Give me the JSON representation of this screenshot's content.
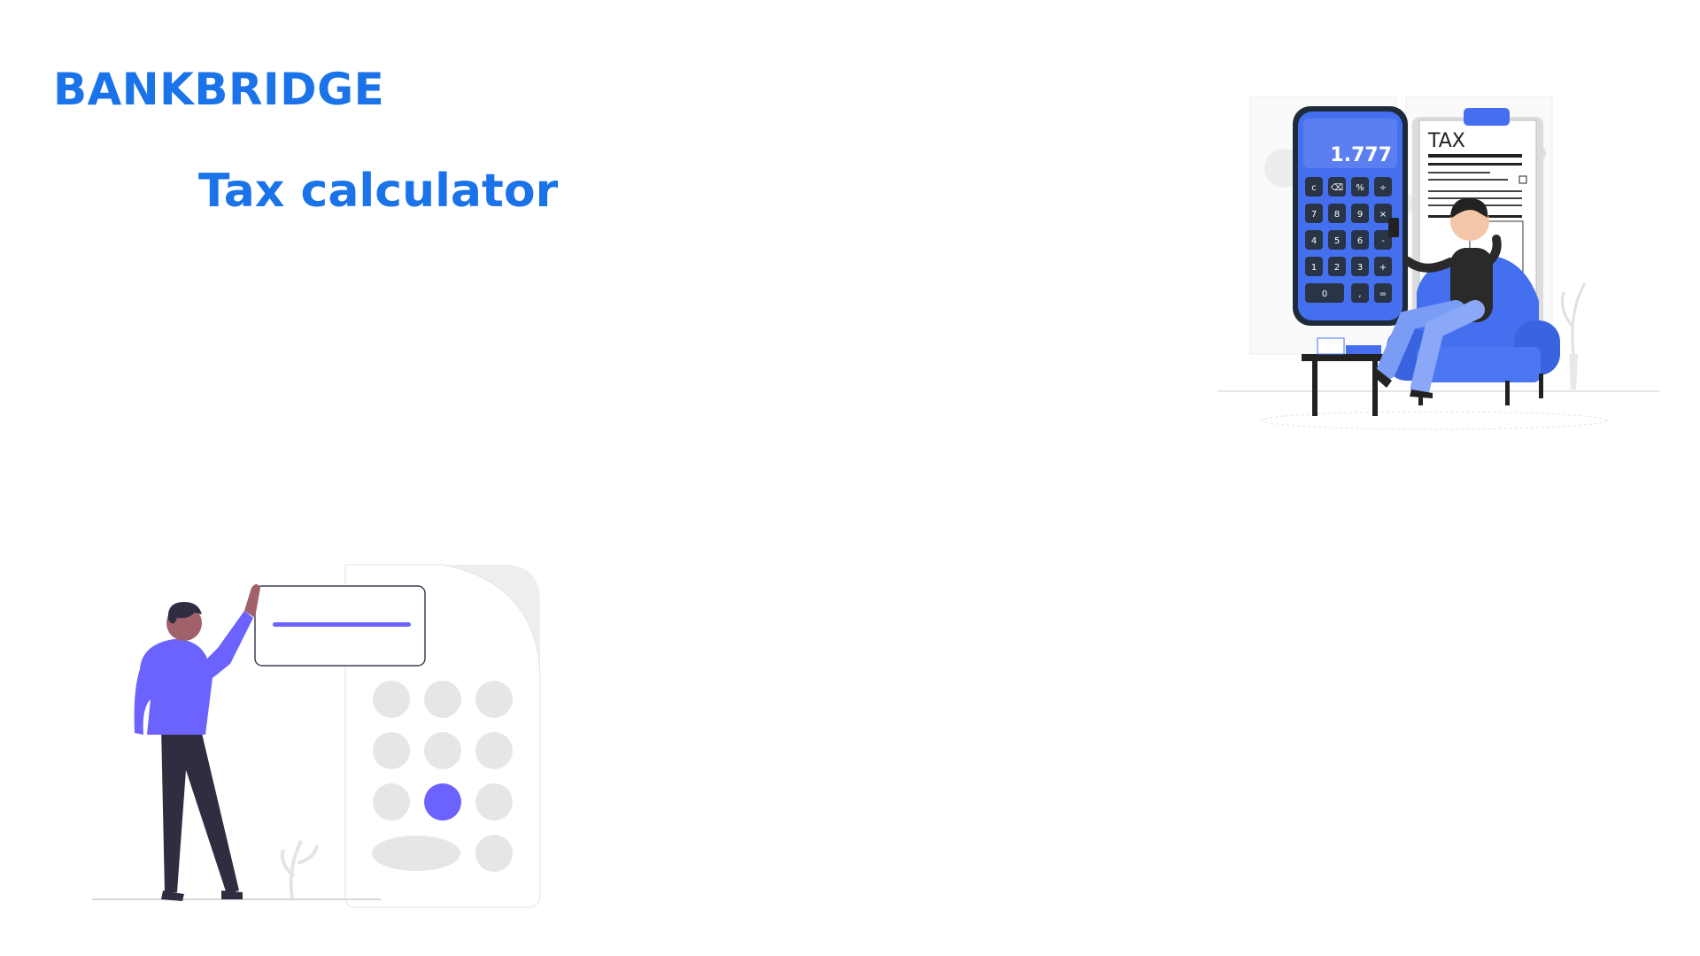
{
  "header": {
    "brand": "BANKBRIDGE",
    "title": "Tax calculator"
  },
  "illustrations": {
    "right": {
      "icon": "man-with-phone-calculator-and-tax-form-illustration",
      "display_value": "1.777",
      "form_label": "TAX",
      "keypad_keys": [
        "c",
        "⌫",
        "%",
        "÷",
        "7",
        "8",
        "9",
        "×",
        "4",
        "5",
        "6",
        "-",
        "1",
        "2",
        "3",
        "+",
        "0",
        ",",
        "="
      ]
    },
    "left": {
      "icon": "man-at-giant-calculator-illustration"
    }
  },
  "colors": {
    "brand": "#1a73e8",
    "illustration_blue": "#4470f0",
    "illustration_purple": "#6c63ff",
    "neutral_gray": "#e6e6e6"
  }
}
